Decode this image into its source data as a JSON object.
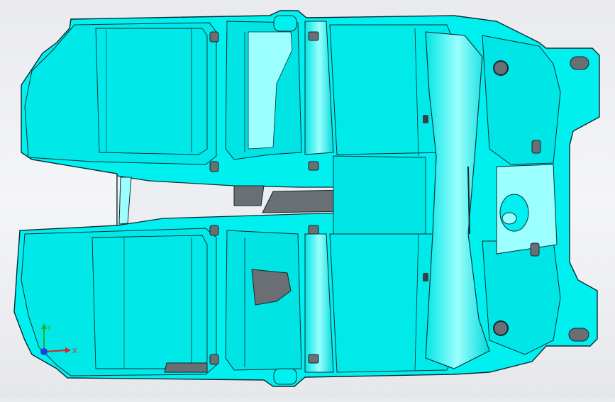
{
  "viewport": {
    "model_color": "#00f0f0",
    "shade_color": "#00cfd2",
    "highlight_color": "#9cffff",
    "edge_color": "#0b2a30",
    "background_color": "#eceef1"
  },
  "triad": {
    "x_label": "X",
    "y_label": "Y",
    "x_color": "#e02020",
    "y_color": "#20b020",
    "z_color": "#2040e0"
  }
}
